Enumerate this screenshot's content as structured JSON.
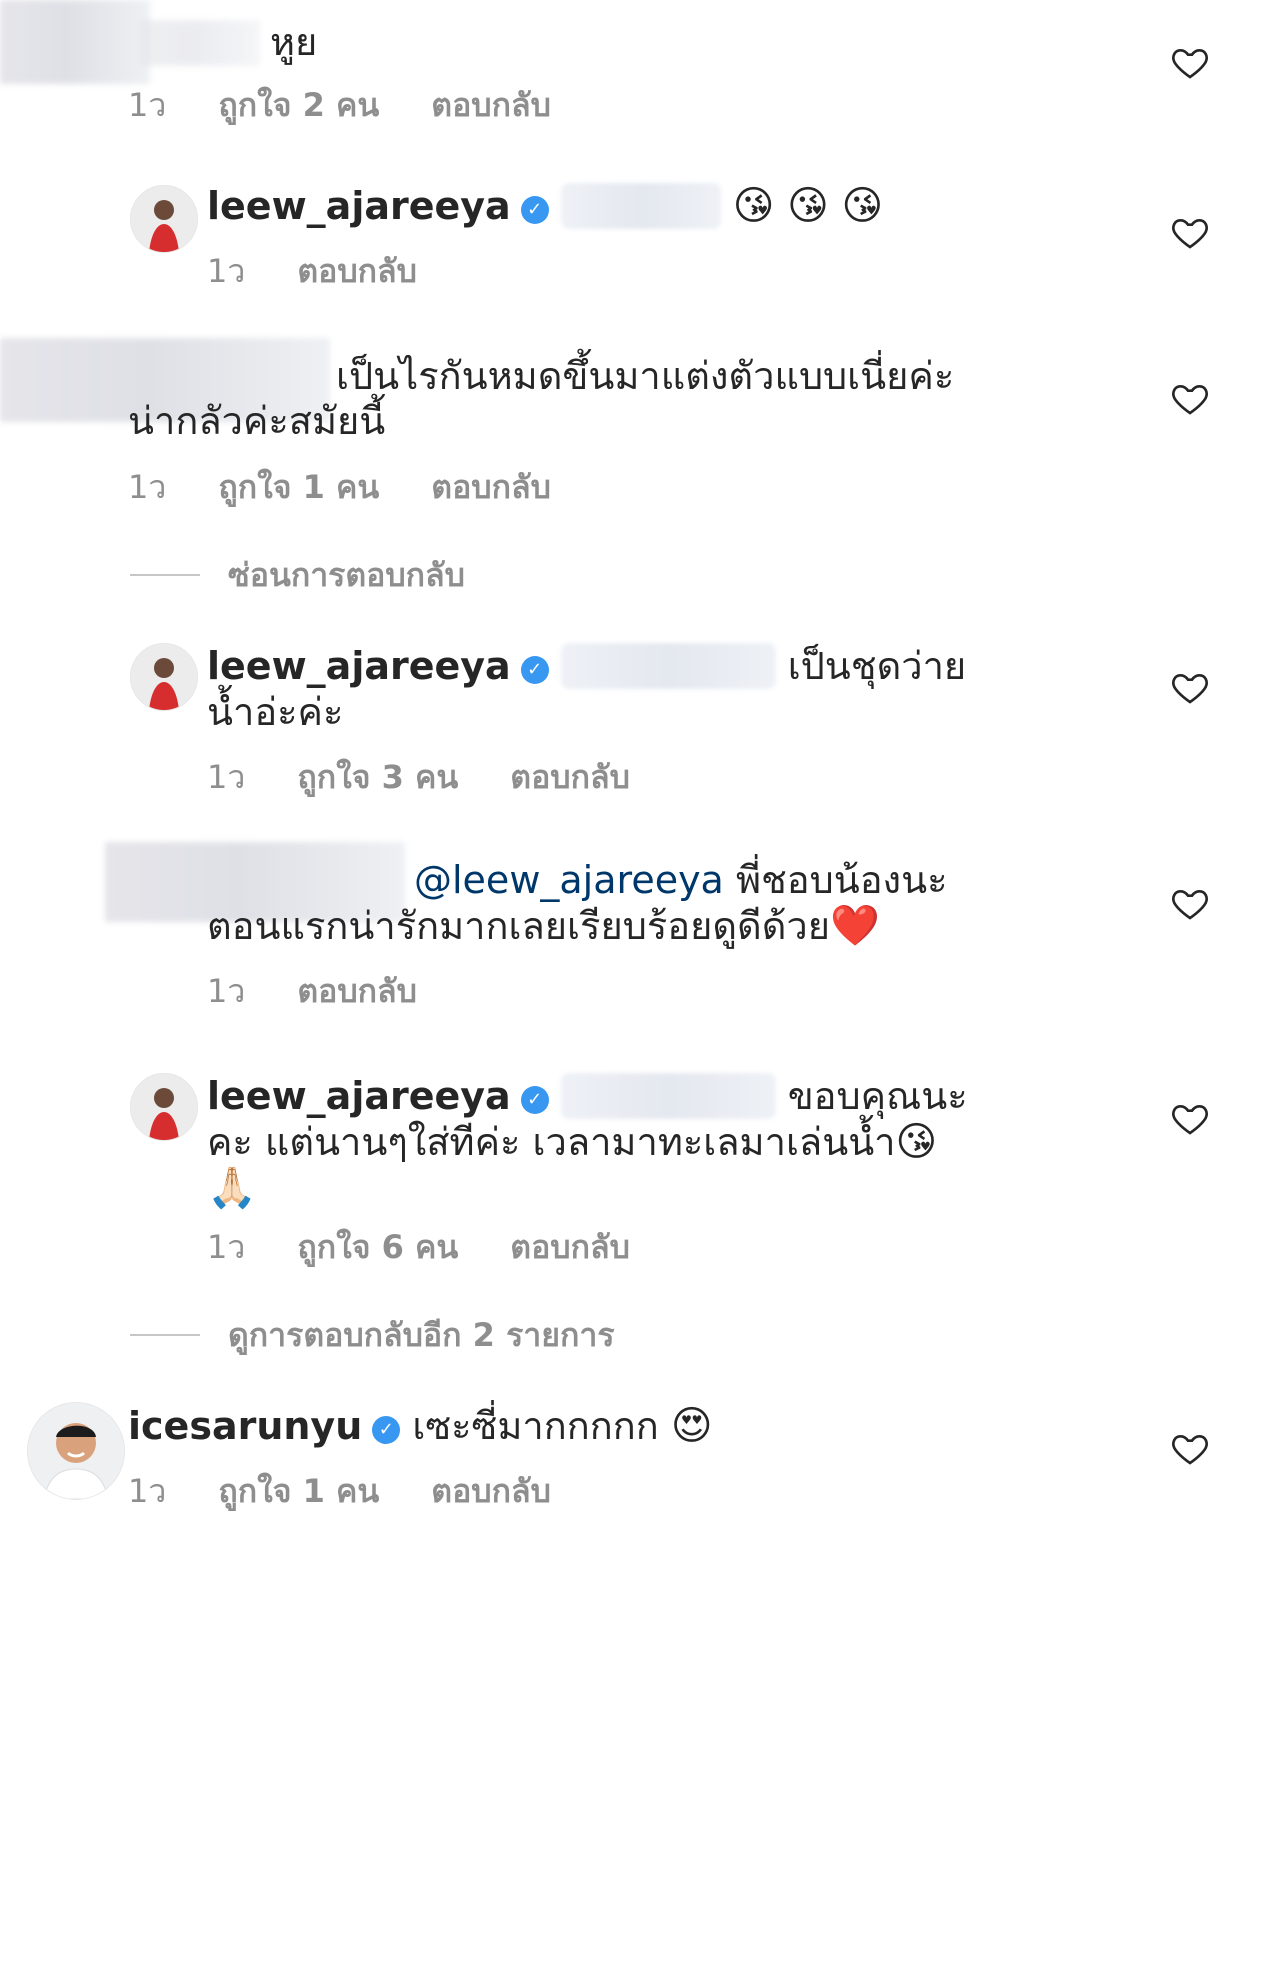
{
  "colors": {
    "text": "#262626",
    "meta": "#8e8e8e",
    "mention": "#00376b",
    "verified": "#3897f0",
    "heart_stroke": "#262626"
  },
  "comments": [
    {
      "text": "หูย",
      "time": "1ว",
      "likes": "ถูกใจ 2 คน",
      "reply": "ตอบกลับ"
    },
    {
      "user": "leew_ajareeya",
      "emoji": "😘 😘 😘",
      "time": "1ว",
      "reply": "ตอบกลับ"
    },
    {
      "text_line1": "เป็นไรกันหมดขึ้นมาแต่งตัวแบบเนี่ยค่ะ",
      "text_line2": "น่ากลัวค่ะสมัยนี้",
      "time": "1ว",
      "likes": "ถูกใจ 1 คน",
      "reply": "ตอบกลับ"
    },
    {
      "user": "leew_ajareeya",
      "text_line1": "เป็นชุดว่าย",
      "text_line2": "น้ำอ่ะค่ะ",
      "time": "1ว",
      "likes": "ถูกใจ 3 คน",
      "reply": "ตอบกลับ"
    },
    {
      "mention": "@leew_ajareeya",
      "text_line1": "พี่ชอบน้องนะ",
      "text_line2": "ตอนแรกน่ารักมากเลยเรียบร้อยดูดีด้วย",
      "emoji": "❤️",
      "time": "1ว",
      "reply": "ตอบกลับ"
    },
    {
      "user": "leew_ajareeya",
      "text_line1": "ขอบคุณนะ",
      "text_line2": "คะ แต่นานๆใส่ทีค่ะ เวลามาทะเลมาเล่นน้ำ",
      "emoji": "😘",
      "emoji2": "🙏🏻",
      "time": "1ว",
      "likes": "ถูกใจ 6 คน",
      "reply": "ตอบกลับ"
    },
    {
      "user": "icesarunyu",
      "text": "เซะซี่มากกกกก",
      "emoji": "😍",
      "time": "1ว",
      "likes": "ถูกใจ 1 คน",
      "reply": "ตอบกลับ"
    }
  ],
  "hide_replies": "ซ่อนการตอบกลับ",
  "view_more_replies": "ดูการตอบกลับอีก 2 รายการ",
  "icons": {
    "heart": "heart-outline-icon",
    "verified": "verified-badge-icon"
  }
}
